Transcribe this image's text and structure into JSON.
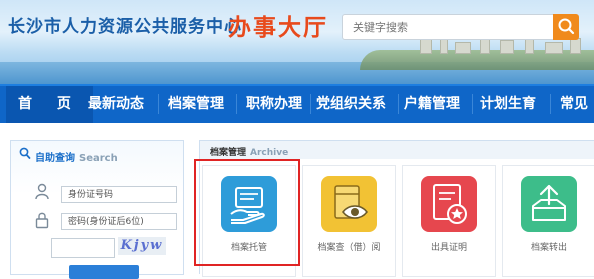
{
  "header": {
    "site_title": "长沙市人力资源公共服务中心",
    "hall_title": "办事大厅",
    "search_placeholder": "关键字搜索"
  },
  "nav": {
    "items": [
      "首 页",
      "最新动态",
      "档案管理",
      "职称办理",
      "党组织关系",
      "户籍管理",
      "计划生育",
      "常见"
    ]
  },
  "self_service": {
    "title": "自助查询",
    "title_en": "Search",
    "id_field": "身份证号码",
    "password_field": "密码(身份证后6位)",
    "captcha": "Kjyw"
  },
  "archive": {
    "title": "档案管理",
    "title_en": "Archive",
    "services": [
      {
        "label": "档案托管",
        "color": "#2e9cd9",
        "icon": "hand-card-icon"
      },
      {
        "label": "档案查（借）阅",
        "color": "#f2c234",
        "icon": "eye-folder-icon"
      },
      {
        "label": "出具证明",
        "color": "#e6474e",
        "icon": "certificate-star-icon"
      },
      {
        "label": "档案转出",
        "color": "#3dbd8a",
        "icon": "upload-box-icon"
      }
    ]
  },
  "colors": {
    "nav_bg": "#0f66c8",
    "highlight": "#e02424",
    "hall_title": "#e84a1c",
    "site_title": "#1b5fa8"
  }
}
